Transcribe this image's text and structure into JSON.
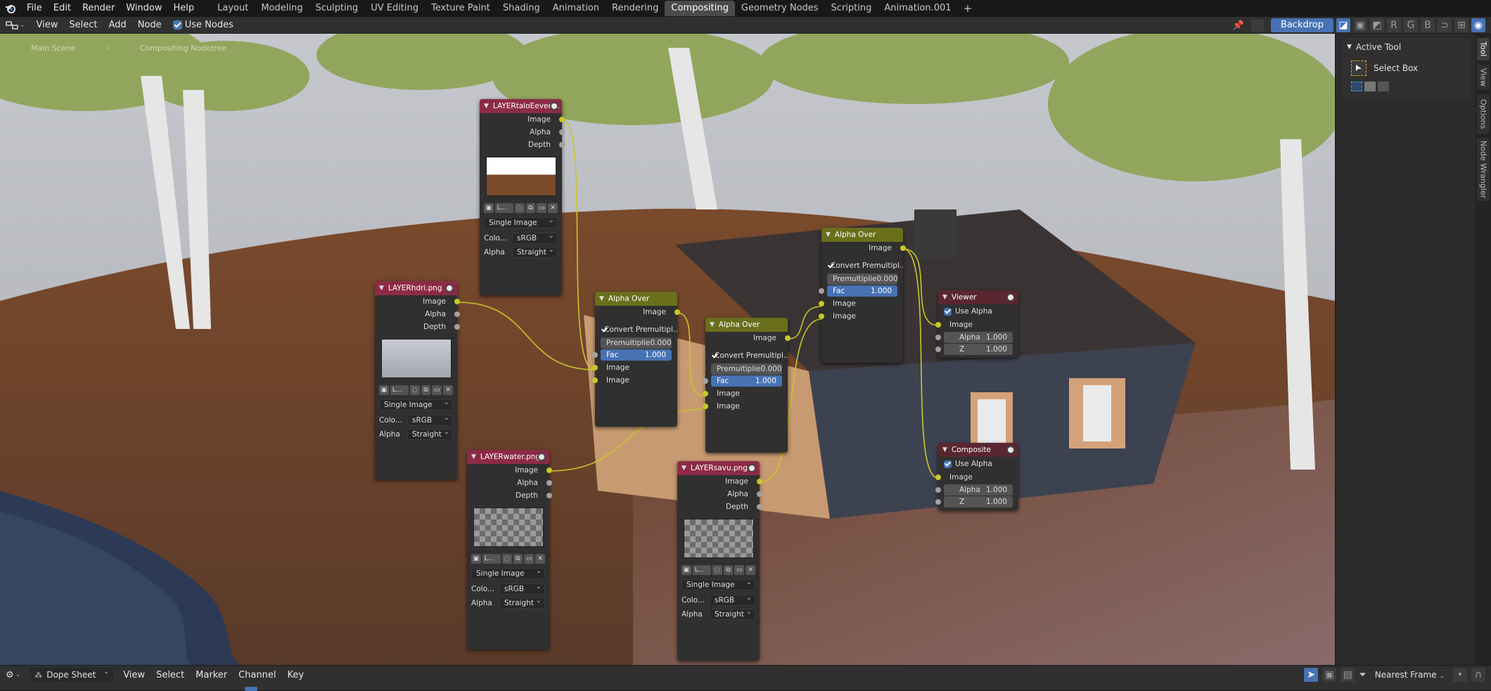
{
  "menubar": {
    "menus": [
      "File",
      "Edit",
      "Render",
      "Window",
      "Help"
    ],
    "workspaces": [
      "Layout",
      "Modeling",
      "Sculpting",
      "UV Editing",
      "Texture Paint",
      "Shading",
      "Animation",
      "Rendering",
      "Compositing",
      "Geometry Nodes",
      "Scripting",
      "Animation.001"
    ],
    "active_workspace": "Compositing"
  },
  "header": {
    "view": "View",
    "select": "Select",
    "add": "Add",
    "node": "Node",
    "use_nodes": "Use Nodes",
    "backdrop": "Backdrop",
    "channels": [
      "R",
      "G",
      "B"
    ]
  },
  "viewport": {
    "breadcrumb_scene": "Main Scene",
    "breadcrumb_tree": "Compositing Nodetree"
  },
  "nodes": {
    "talo": {
      "title": "LAYERtaloEevee...",
      "outputs": [
        "Image",
        "Alpha",
        "Depth"
      ],
      "image_name": "L...",
      "source": "Single Image",
      "color_label": "Colo...",
      "color_value": "sRGB",
      "alpha_label": "Alpha",
      "alpha_value": "Straight"
    },
    "hdri": {
      "title": "LAYERhdri.png",
      "outputs": [
        "Image",
        "Alpha",
        "Depth"
      ],
      "image_name": "L...",
      "source": "Single Image",
      "color_label": "Colo...",
      "color_value": "sRGB",
      "alpha_label": "Alpha",
      "alpha_value": "Straight"
    },
    "water": {
      "title": "LAYERwater.png",
      "outputs": [
        "Image",
        "Alpha",
        "Depth"
      ],
      "image_name": "L...",
      "source": "Single Image",
      "color_label": "Colo...",
      "color_value": "sRGB",
      "alpha_label": "Alpha",
      "alpha_value": "Straight"
    },
    "savu": {
      "title": "LAYERsavu.png",
      "outputs": [
        "Image",
        "Alpha",
        "Depth"
      ],
      "image_name": "L...",
      "source": "Single Image",
      "color_label": "Colo...",
      "color_value": "sRGB",
      "alpha_label": "Alpha",
      "alpha_value": "Straight"
    },
    "over1": {
      "title": "Alpha Over",
      "output": "Image",
      "convert": "Convert Premultipl...",
      "premul_label": "Premultiplie",
      "premul_value": "0.000",
      "fac_label": "Fac",
      "fac_value": "1.000",
      "in1": "Image",
      "in2": "Image"
    },
    "over2": {
      "title": "Alpha Over",
      "output": "Image",
      "convert": "Convert Premultipl...",
      "premul_label": "Premultiplie",
      "premul_value": "0.000",
      "fac_label": "Fac",
      "fac_value": "1.000",
      "in1": "Image",
      "in2": "Image"
    },
    "over3": {
      "title": "Alpha Over",
      "output": "Image",
      "convert": "Convert Premultipl...",
      "premul_label": "Premultiplie",
      "premul_value": "0.000",
      "fac_label": "Fac",
      "fac_value": "1.000",
      "in1": "Image",
      "in2": "Image"
    },
    "viewer": {
      "title": "Viewer",
      "use_alpha": "Use Alpha",
      "image": "Image",
      "alpha_label": "Alpha",
      "alpha_value": "1.000",
      "z_label": "Z",
      "z_value": "1.000"
    },
    "composite": {
      "title": "Composite",
      "use_alpha": "Use Alpha",
      "image": "Image",
      "alpha_label": "Alpha",
      "alpha_value": "1.000",
      "z_label": "Z",
      "z_value": "1.000"
    }
  },
  "sidebar": {
    "panel_title": "Active Tool",
    "tool_name": "Select Box",
    "tabs": [
      "Tool",
      "View",
      "Options",
      "Node Wrangler"
    ]
  },
  "bottom": {
    "editor": "Dope Sheet",
    "menus": [
      "View",
      "Select",
      "Marker",
      "Channel",
      "Key"
    ],
    "snap": "Nearest Frame"
  },
  "colors": {
    "accent": "#4772b3",
    "image_node": "#8d2b47",
    "mix_node": "#6a6f1c",
    "output_node": "#5a2630",
    "socket_image": "#c7c729"
  }
}
